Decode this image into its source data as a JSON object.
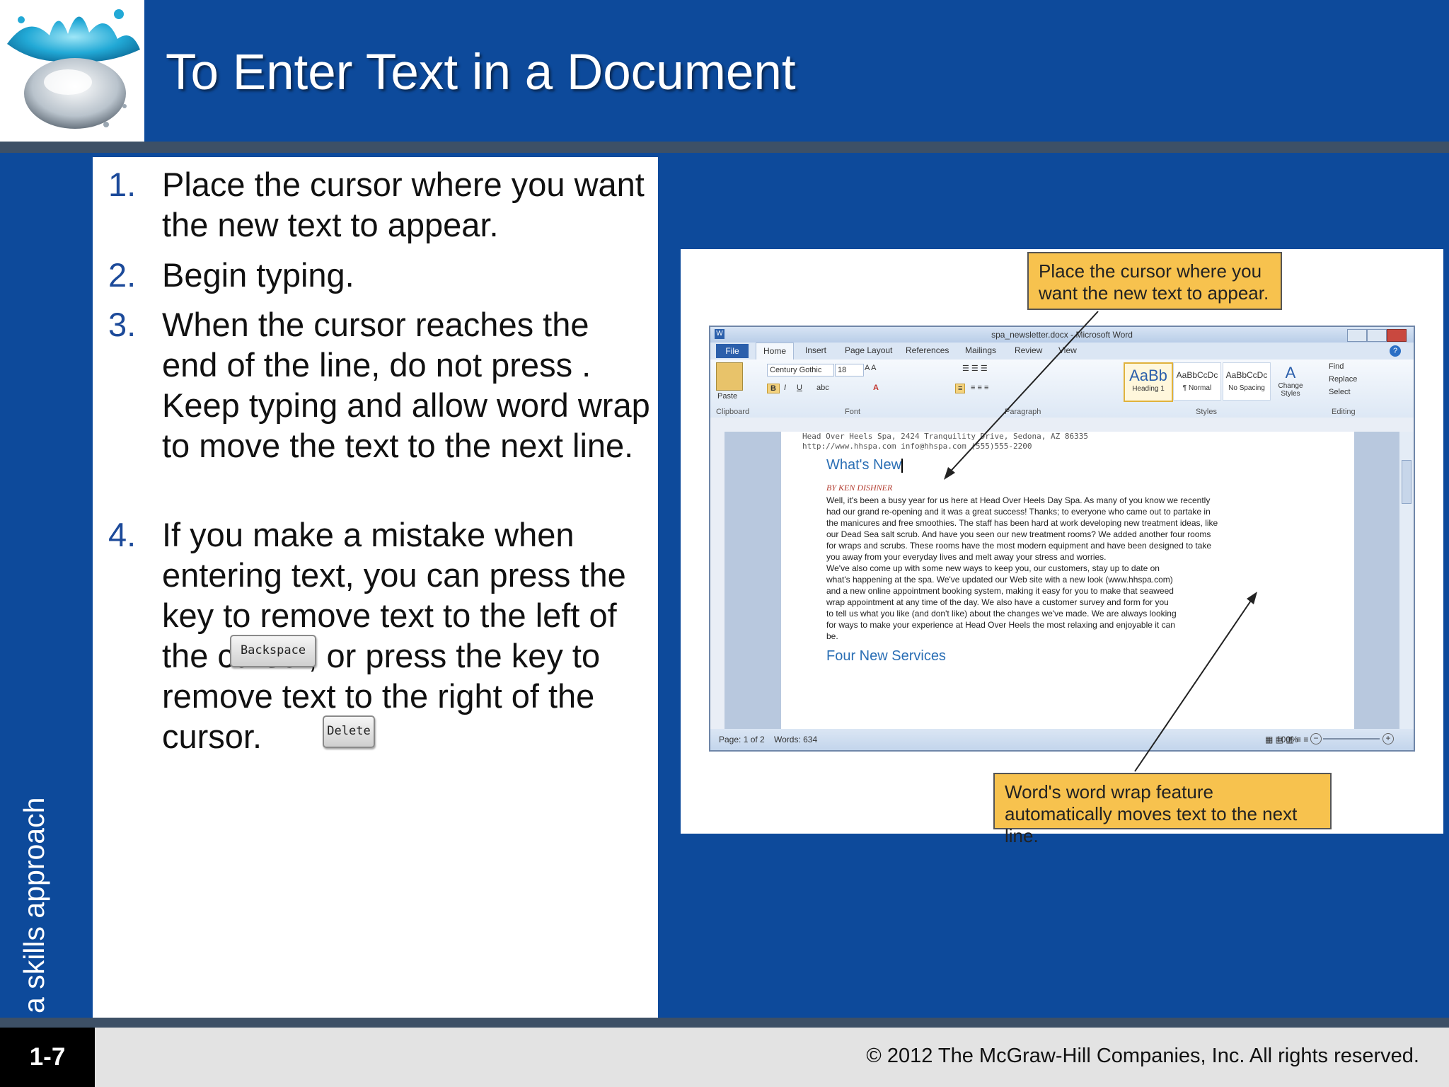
{
  "slide": {
    "title": "To Enter Text in a Document",
    "side_label": "a skills approach",
    "number": "1-7",
    "copyright": "© 2012 The McGraw-Hill Companies, Inc. All rights reserved."
  },
  "steps": [
    {
      "num": "1.",
      "text": "Place the cursor where you want the new text to appear."
    },
    {
      "num": "2.",
      "text": "Begin typing."
    },
    {
      "num": "3.",
      "text": "When the cursor reaches the end of the line, do not press . Keep typing and allow word wrap to move the text to the next line."
    },
    {
      "num": "4.",
      "text": "If you make a mistake when entering text, you can press the key to remove text to the left of the cursor, or press the key to remove text to the right of the cursor."
    }
  ],
  "keys": {
    "backspace": "Backspace",
    "delete": "Delete"
  },
  "figure": {
    "callout_top": "Place the cursor where you want the new text to appear.",
    "callout_bottom": "Word's word wrap feature automatically moves text to the next line.",
    "word": {
      "title": "spa_newsletter.docx - Microsoft Word",
      "tabs": [
        "File",
        "Home",
        "Insert",
        "Page Layout",
        "References",
        "Mailings",
        "Review",
        "View"
      ],
      "font_name": "Century Gothic",
      "font_size": "18",
      "group_labels": [
        "Clipboard",
        "Font",
        "Paragraph",
        "Styles",
        "Editing"
      ],
      "paste_label": "Paste",
      "styles": [
        {
          "preview": "AaBb",
          "name": "Heading 1"
        },
        {
          "preview": "AaBbCcDc",
          "name": "¶ Normal"
        },
        {
          "preview": "AaBbCcDc",
          "name": "No Spacing"
        }
      ],
      "change_styles": "Change Styles",
      "editing": [
        "Find",
        "Replace",
        "Select"
      ],
      "doc": {
        "address1": "Head Over Heels Spa, 2424 Tranquility Drive, Sedona, AZ 86335",
        "address2": "http://www.hhspa.com     info@hhspa.com     (555)555-2200",
        "heading1": "What's New",
        "byline": "BY KEN DISHNER",
        "para1": [
          "Well, it's been a busy year for us here at Head Over Heels Day Spa. As many of you know we recently",
          "had our grand re-opening and it was a great success! Thanks; to everyone who came out to partake in",
          "the manicures and free smoothies. The staff has been hard at work developing new treatment ideas, like",
          "our Dead Sea salt scrub. And have you seen our new treatment rooms? We added another four rooms",
          "for wraps and scrubs. These rooms have the most modern equipment and have been designed to take",
          "you away from your everyday lives and melt away your stress and worries."
        ],
        "para2": [
          "We've also come up with some new ways to keep you, our customers, stay up to date on",
          "what's happening at the spa. We've updated our Web site with a new look (www.hhspa.com)",
          "and a new online appointment booking system, making it easy for you to make that seaweed",
          "wrap appointment at any time of the day. We also have a customer survey and form for you",
          "to tell us what you like (and don't like) about the changes we've made. We are always looking",
          "for ways to make your experience at Head Over Heels the most relaxing and enjoyable it can",
          "be."
        ],
        "heading2": "Four New Services"
      },
      "status_page": "Page: 1 of 2",
      "status_words": "Words: 634",
      "zoom": "100%"
    }
  },
  "colors": {
    "brand_blue": "#0d4a9b",
    "step_number": "#1c4a9a",
    "callout": "#f7c24e"
  }
}
